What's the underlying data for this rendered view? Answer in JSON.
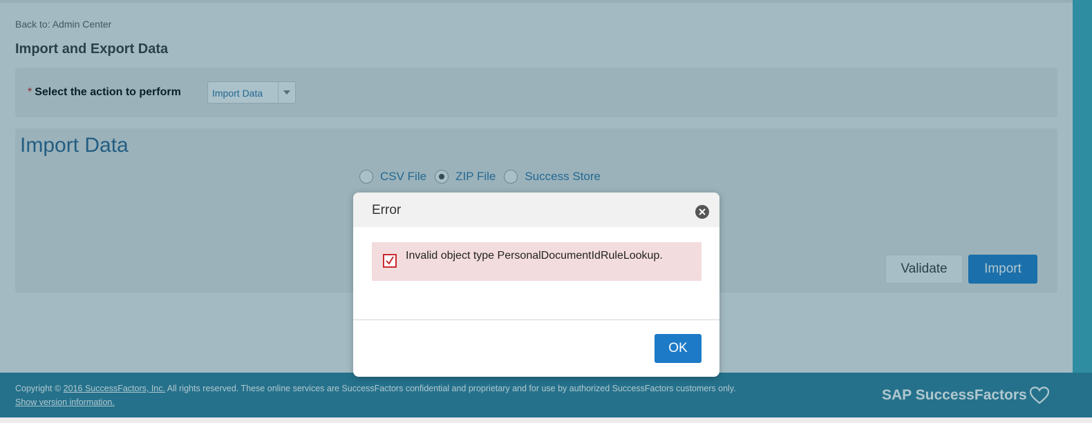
{
  "header": {
    "back_link": "Back to: Admin Center",
    "title": "Import and Export Data"
  },
  "action": {
    "required_mark": "*",
    "label": "Select the action to perform",
    "selected": "Import Data",
    "arrow_icon": "chevron-down-icon"
  },
  "import": {
    "title": "Import Data",
    "file_types": [
      {
        "label": "CSV File",
        "selected": false
      },
      {
        "label": "ZIP File",
        "selected": true
      },
      {
        "label": "Success Store",
        "selected": false
      }
    ],
    "validate_label": "Validate",
    "import_label": "Import"
  },
  "footer": {
    "copyright_prefix": "Copyright ©",
    "copyright_link": "2016 SuccessFactors, Inc.",
    "copyright_suffix": "All rights reserved. These online services are SuccessFactors confidential and proprietary and for use by authorized SuccessFactors customers only.",
    "version_link": "Show version information.",
    "logo_text": "SAP SuccessFactors"
  },
  "modal": {
    "title": "Error",
    "close_icon": "close-icon",
    "message": "Invalid object type PersonalDocumentIdRuleLookup.",
    "ok_label": "OK"
  },
  "colors": {
    "primary_button": "#1d7ac7",
    "footer": "#2d7d98",
    "error_background": "#f3dcdd",
    "error_accent": "#c8292e"
  }
}
